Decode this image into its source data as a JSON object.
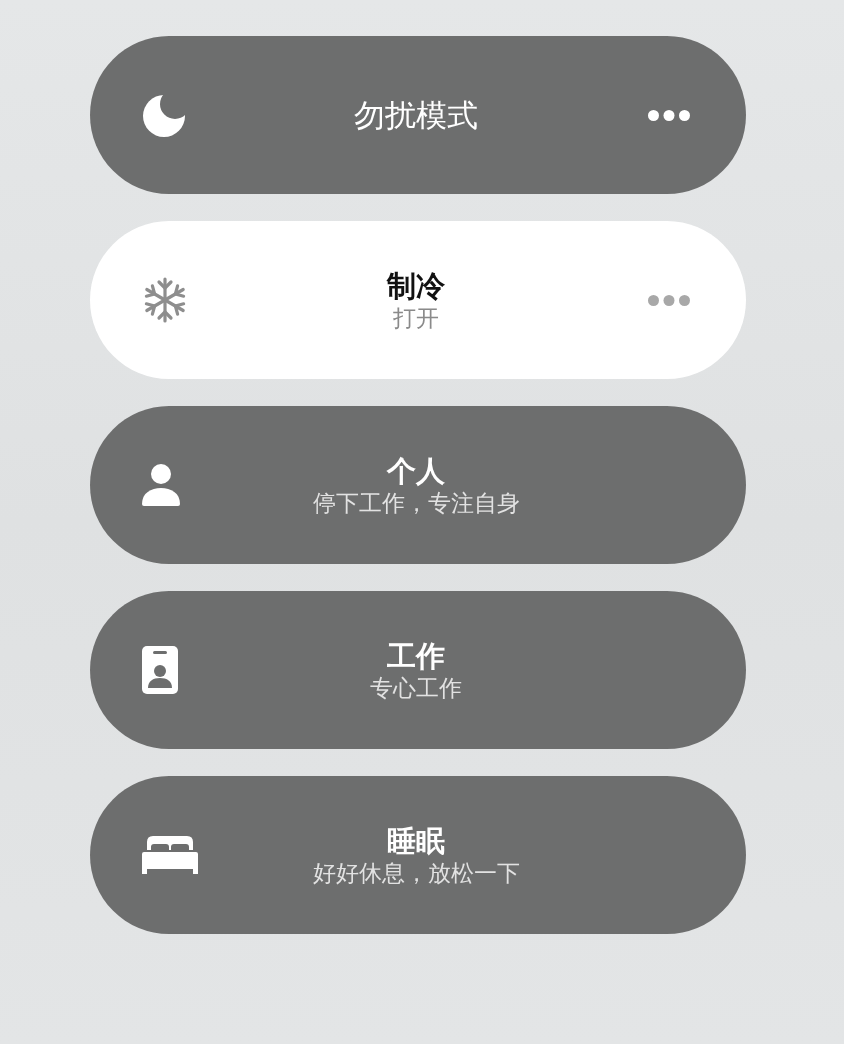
{
  "modes": [
    {
      "title": "勿扰模式",
      "selected": false,
      "menu_button": true
    },
    {
      "title": "制冷",
      "subtitle": "打开",
      "selected": true,
      "menu_button": true
    },
    {
      "title": "个人",
      "subtitle": "停下工作，专注自身",
      "selected": false,
      "menu_button": false
    },
    {
      "title": "工作",
      "subtitle": "专心工作",
      "selected": false,
      "menu_button": false
    },
    {
      "title": "睡眠",
      "subtitle": "好好休息，放松一下",
      "selected": false,
      "menu_button": false
    }
  ]
}
